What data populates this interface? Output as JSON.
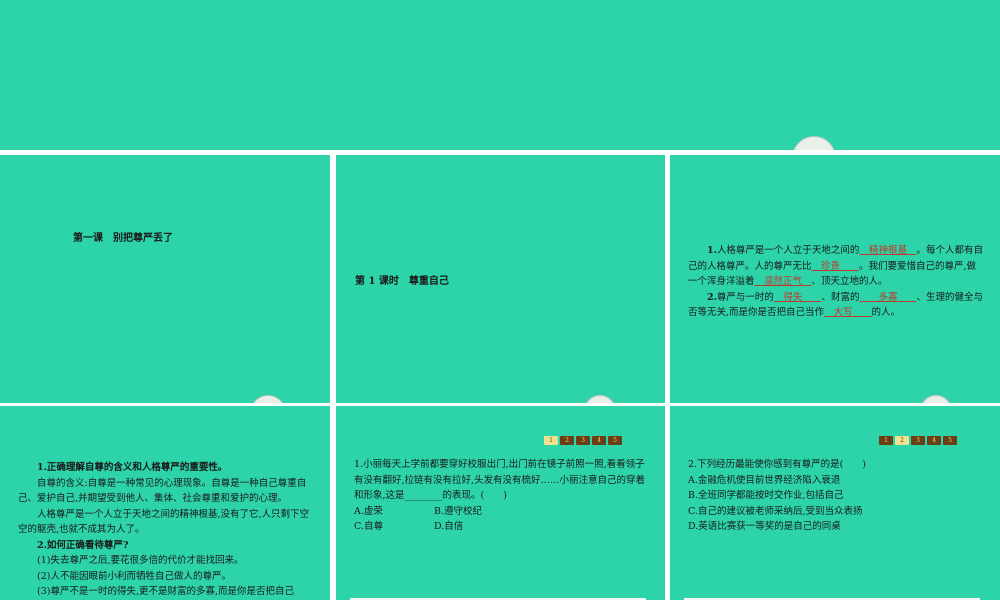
{
  "slide1": {
    "lesson_title": "第一课　别把尊严丢了"
  },
  "slide2": {
    "section_title": "第 1 课时　尊重自己"
  },
  "slide3": {
    "p1_num": "1.",
    "p1_a": "人格尊严是一个人立于天地之间的",
    "p1_ans1": "　精神根基　",
    "p1_b": "。每个人都有自己的人格尊严。人的尊严无比",
    "p1_ans2": "　珍贵　　",
    "p1_c": "。我们要爱惜自己的尊严,做一个浑身洋溢着",
    "p1_ans3": "　凛然正气　",
    "p1_d": "、顶天立地的人。",
    "p2_num": "2.",
    "p2_a": "尊严与一时的",
    "p2_ans1": "　得失　　",
    "p2_b": "、财富的",
    "p2_ans2": "　　多寡　　",
    "p2_c": "、生理的健全与否等无关,而是你是否把自己当作",
    "p2_ans3": "　大写　　",
    "p2_d": "的人。"
  },
  "slide4": {
    "h1": "1.正确理解自尊的含义和人格尊严的重要性。",
    "l1": "自尊的含义:自尊是一种常见的心理现象。自尊是一种自己尊重自己、爱护自己,并期望受到他人、集体、社会尊重和爱护的心理。",
    "l2": "人格尊严是一个人立于天地之间的精神根基,没有了它,人只剩下空空的躯壳,也就不成其为人了。",
    "h2": "2.如何正确看待尊严?",
    "l3": "(1)失去尊严之后,要花很多倍的代价才能找回来。",
    "l4": "(2)人不能因眼前小利而牺牲自己做人的尊严。",
    "l5": "(3)尊严不是一时的得失,更不是财富的多寡,而是你是否把自己"
  },
  "slide5": {
    "nav": [
      "1",
      "2",
      "3",
      "4",
      "5"
    ],
    "active_index": 0,
    "question": "1.小丽每天上学前都要穿好校服出门,出门前在镜子前照一照,看看领子有没有翻好,拉链有没有拉好,头发有没有梳好……小丽注意自己的穿着和形象,这是________的表现。(　　)",
    "options": [
      "A.虚荣",
      "B.遵守校纪",
      "C.自尊",
      "D.自信"
    ]
  },
  "slide6": {
    "nav": [
      "1",
      "2",
      "3",
      "4",
      "5"
    ],
    "active_index": 1,
    "question": "2.下列经历最能使你感到有尊严的是(　　)",
    "options": [
      "A.金融危机使目前世界经济陷入衰退",
      "B.全班同学都能按时交作业,包括自己",
      "C.自己的建议被老师采纳后,受到当众表扬",
      "D.英语比赛获一等奖的是自己的同桌"
    ]
  }
}
